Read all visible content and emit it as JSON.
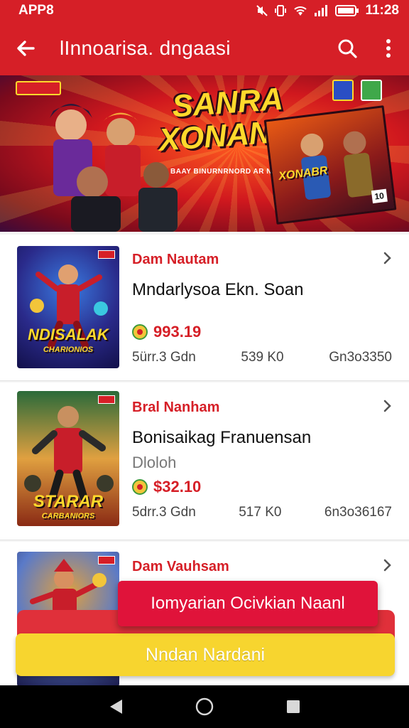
{
  "status": {
    "app_label": "APP8",
    "time": "11:28"
  },
  "appbar": {
    "title": "lInnoarisa. dngaasi",
    "back_icon": "arrow-left-icon",
    "search_icon": "search-icon",
    "menu_icon": "more-vert-icon"
  },
  "banner": {
    "title_line1": "SANRA",
    "title_line2": "XONANAN",
    "tagline": "BAAY BINURNRNORD AR NNARBIQ",
    "boxart_title": "XONABR",
    "boxart_badge": "10"
  },
  "items": [
    {
      "tag": "Dam Nautam",
      "name": "Mndarlysoa Ekn. Soan",
      "subtitle": "",
      "price": "993.19",
      "meta_left": "5ürr.3 Gdn",
      "meta_mid": "539 K0",
      "meta_right": "Gn3o3350",
      "thumb_text": "NDISALAK",
      "thumb_subtext": "CHARIONIOS"
    },
    {
      "tag": "Bral Nanham",
      "name": "Bonisaikag Franuensan",
      "subtitle": "Dloloh",
      "price": "$32.10",
      "meta_left": "5drr.3 Gdn",
      "meta_mid": "517 K0",
      "meta_right": "6n3o36167",
      "thumb_text": "STARAR",
      "thumb_subtext": "CARBANIORS"
    },
    {
      "tag": "Dam Vauhsam",
      "name": "",
      "subtitle": "",
      "price": "",
      "meta_left": "",
      "meta_mid": "",
      "meta_right": "",
      "thumb_text": "",
      "thumb_subtext": ""
    }
  ],
  "popup": {
    "label": "Iomyarian Ocivkian Naanl"
  },
  "cta": {
    "label": "Nndan Nardani"
  },
  "colors": {
    "primary": "#d61f27",
    "accent_yellow": "#f7d52f",
    "price": "#d61f27"
  }
}
